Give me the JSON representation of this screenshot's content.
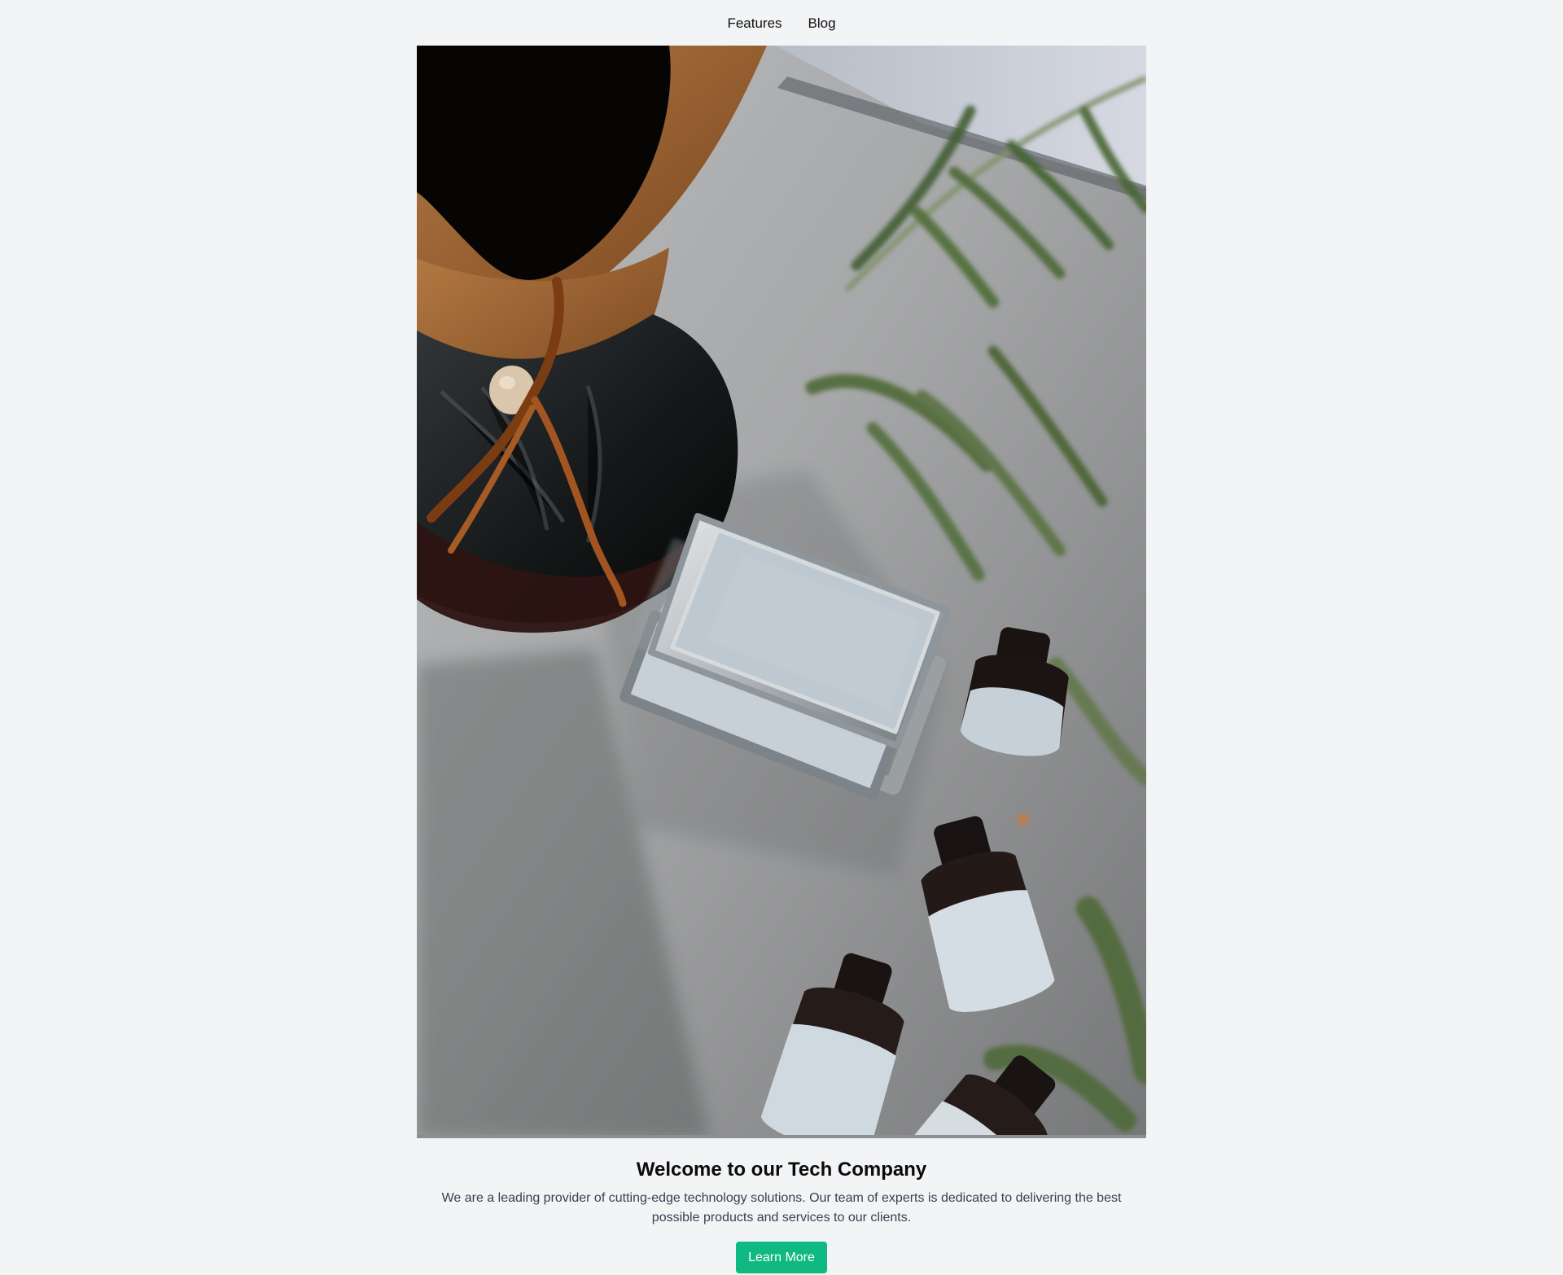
{
  "navigation": {
    "items": [
      {
        "label": "Features"
      },
      {
        "label": "Blog"
      }
    ]
  },
  "hero": {
    "image_icon": "still-life-photo-icon",
    "title": "Welcome to our Tech Company",
    "description": "We are a leading provider of cutting-edge technology solutions. Our team of experts is dedicated to delivering the best possible products and services to our clients.",
    "button_label": "Learn More"
  },
  "colors": {
    "page_background": "#f3f4f6",
    "heading": "#0b0b0b",
    "body_text": "#374151",
    "button_background": "#10b981",
    "button_text": "#ffffff"
  }
}
